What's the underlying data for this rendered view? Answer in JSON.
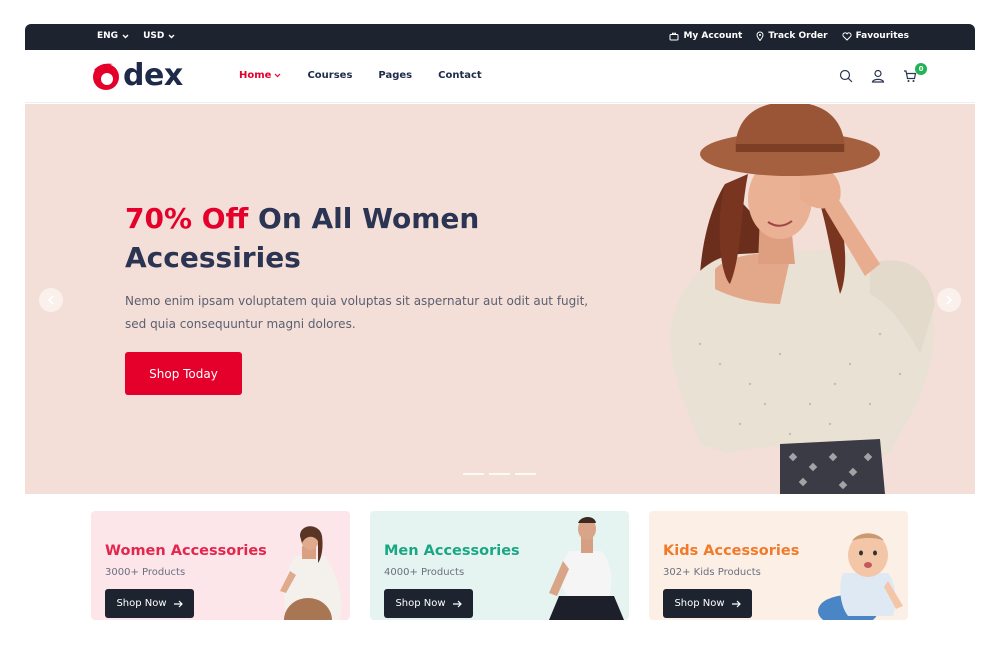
{
  "topbar": {
    "language": "ENG",
    "currency": "USD",
    "my_account": "My Account",
    "track_order": "Track Order",
    "favourites": "Favourites"
  },
  "header": {
    "logo_text": "dex",
    "nav": [
      {
        "label": "Home"
      },
      {
        "label": "Courses"
      },
      {
        "label": "Pages"
      },
      {
        "label": "Contact"
      }
    ],
    "cart_count": "0"
  },
  "hero": {
    "title_highlight": "70% Off",
    "title_rest": " On All Women Accessiries",
    "description": "Nemo enim ipsam voluptatem quia voluptas sit aspernatur aut odit aut fugit, sed quia consequuntur magni dolores.",
    "button_label": "Shop Today"
  },
  "categories": [
    {
      "title": "Women Accessories",
      "subtitle": "3000+ Products",
      "button": "Shop Now",
      "color": "#e4264d",
      "bg": "#fce6ea"
    },
    {
      "title": "Men Accessories",
      "subtitle": "4000+ Products",
      "button": "Shop Now",
      "color": "#1aa884",
      "bg": "#e6f4f1"
    },
    {
      "title": "Kids Accessories",
      "subtitle": "302+ Kids Products",
      "button": "Shop Now",
      "color": "#f07a2a",
      "bg": "#fcefe6"
    }
  ],
  "colors": {
    "brand_red": "#e4002b",
    "dark_navy": "#1e2330",
    "hero_bg": "#f4dfd8",
    "badge_green": "#20b455"
  },
  "icons": [
    "chevron-down-icon",
    "briefcase-icon",
    "location-pin-icon",
    "heart-icon",
    "search-icon",
    "user-icon",
    "cart-icon",
    "chevron-left-icon",
    "chevron-right-icon",
    "arrow-right-icon"
  ]
}
